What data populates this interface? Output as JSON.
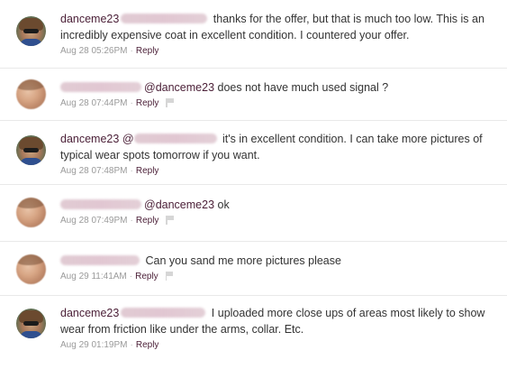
{
  "comments": [
    {
      "author": "danceme23",
      "mention_hidden": "rosariogamboa",
      "mention": "",
      "text": " thanks for the offer, but that is much too low. This is an incredibly expensive coat in excellent condition. I countered your offer.",
      "timestamp": "Aug 28 05:26PM",
      "reply_label": "Reply",
      "flag_icon": "flag-icon"
    },
    {
      "author_hidden": "rosariogamboa",
      "mention": "@danceme23",
      "text": " does not have much used signal ?",
      "timestamp": "Aug 28 07:44PM",
      "reply_label": "Reply",
      "flag_icon": "flag-icon"
    },
    {
      "author": "danceme23",
      "mention_prefix": "@",
      "mention_hidden": "rosariogamboa",
      "text": " it's in excellent condition. I can take more pictures of typical wear spots tomorrow if you want.",
      "timestamp": "Aug 28 07:48PM",
      "reply_label": "Reply"
    },
    {
      "author_hidden": "rosariogamboa",
      "mention": "@danceme23",
      "text": " ok",
      "timestamp": "Aug 28 07:49PM",
      "reply_label": "Reply",
      "flag_icon": "flag-icon"
    },
    {
      "author_hidden": "rosariogamboa",
      "text": " Can you sand me more pictures please",
      "timestamp": "Aug 29 11:41AM",
      "reply_label": "Reply",
      "flag_icon": "flag-icon"
    },
    {
      "author": "danceme23",
      "mention_hidden": "rosariogamboa",
      "text": " I uploaded more close ups of areas most likely to show wear from friction like under the arms, collar. Etc.",
      "timestamp": "Aug 29 01:19PM",
      "reply_label": "Reply"
    }
  ],
  "separator": "·"
}
